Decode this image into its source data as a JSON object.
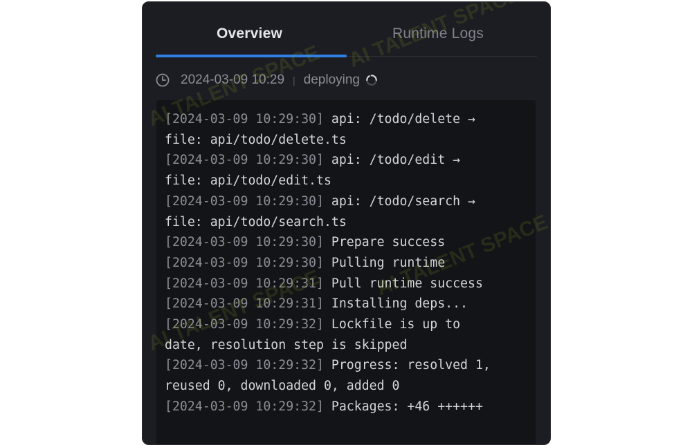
{
  "tabs": [
    {
      "label": "Overview",
      "active": true
    },
    {
      "label": "Runtime Logs",
      "active": false
    }
  ],
  "status": {
    "icon": "clock-icon",
    "timestamp": "2024-03-09 10:29",
    "separator": "|",
    "state": "deploying"
  },
  "logs": [
    {
      "ts": "[2024-03-09 10:29:30]",
      "msg": " api: /todo/delete →",
      "cont": "file: api/todo/delete.ts"
    },
    {
      "ts": "[2024-03-09 10:29:30]",
      "msg": " api: /todo/edit →",
      "cont": "file: api/todo/edit.ts"
    },
    {
      "ts": "[2024-03-09 10:29:30]",
      "msg": " api: /todo/search →",
      "cont": "file: api/todo/search.ts"
    },
    {
      "ts": "[2024-03-09 10:29:30]",
      "msg": " Prepare success",
      "cont": ""
    },
    {
      "ts": "[2024-03-09 10:29:30]",
      "msg": " Pulling runtime",
      "cont": ""
    },
    {
      "ts": "[2024-03-09 10:29:31]",
      "msg": " Pull runtime success",
      "cont": ""
    },
    {
      "ts": "[2024-03-09 10:29:31]",
      "msg": " Installing deps...",
      "cont": ""
    },
    {
      "ts": "[2024-03-09 10:29:32]",
      "msg": " Lockfile is up to",
      "cont": "date, resolution step is skipped"
    },
    {
      "ts": "[2024-03-09 10:29:32]",
      "msg": " Progress: resolved 1,",
      "cont": "reused 0, downloaded 0, added 0"
    },
    {
      "ts": "[2024-03-09 10:29:32]",
      "msg": " Packages: +46 ++++++",
      "cont": ""
    }
  ],
  "watermark": "AI TALENT SPACE",
  "colors": {
    "panel_bg": "#1c1d22",
    "log_bg": "#131417",
    "accent": "#2f7fe6"
  }
}
